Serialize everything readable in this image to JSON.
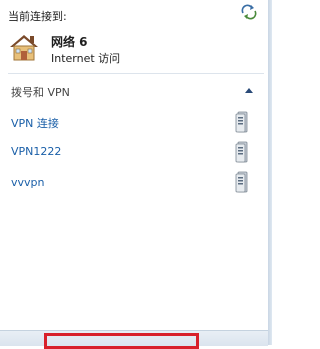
{
  "window": {
    "connected_label": "当前连接到:",
    "network_name": "网络  6",
    "network_access": "Internet 访问"
  },
  "section": {
    "title": "拨号和 VPN",
    "state": "expanded"
  },
  "vpn_items": [
    {
      "label": "VPN 连接",
      "icon": "vpn-connection-icon"
    },
    {
      "label": "VPN1222",
      "icon": "vpn-connection-icon"
    },
    {
      "label": "vvvpn",
      "icon": "vpn-connection-icon"
    }
  ],
  "icons": {
    "refresh": "refresh-icon",
    "network": "home-network-icon",
    "collapse": "chevron-up-icon"
  },
  "colors": {
    "link": "#1a5fa8",
    "highlight": "#d8202a",
    "footer_bg": "#e1e9f2"
  }
}
